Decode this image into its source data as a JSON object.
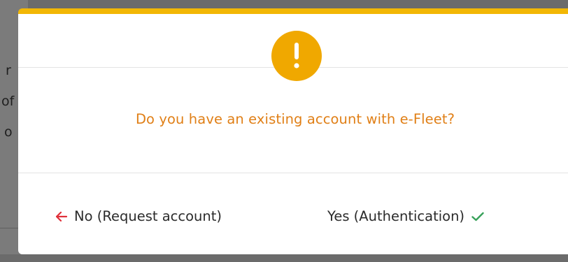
{
  "background": {
    "fragments": [
      "r",
      "of",
      "o"
    ]
  },
  "dialog": {
    "icon": "exclamation-icon",
    "question": "Do you have an existing account with e-Fleet?",
    "no_button": {
      "icon": "arrow-left-icon",
      "label": "No (Request account)"
    },
    "yes_button": {
      "label": "Yes (Authentication)",
      "icon": "check-icon"
    }
  },
  "colors": {
    "accent_bar": "#f2b705",
    "alert_badge": "#f0a800",
    "question_text": "#e07f16",
    "no_arrow": "#e0303a",
    "yes_check": "#38a15a",
    "overlay": "#6b6b6b"
  }
}
